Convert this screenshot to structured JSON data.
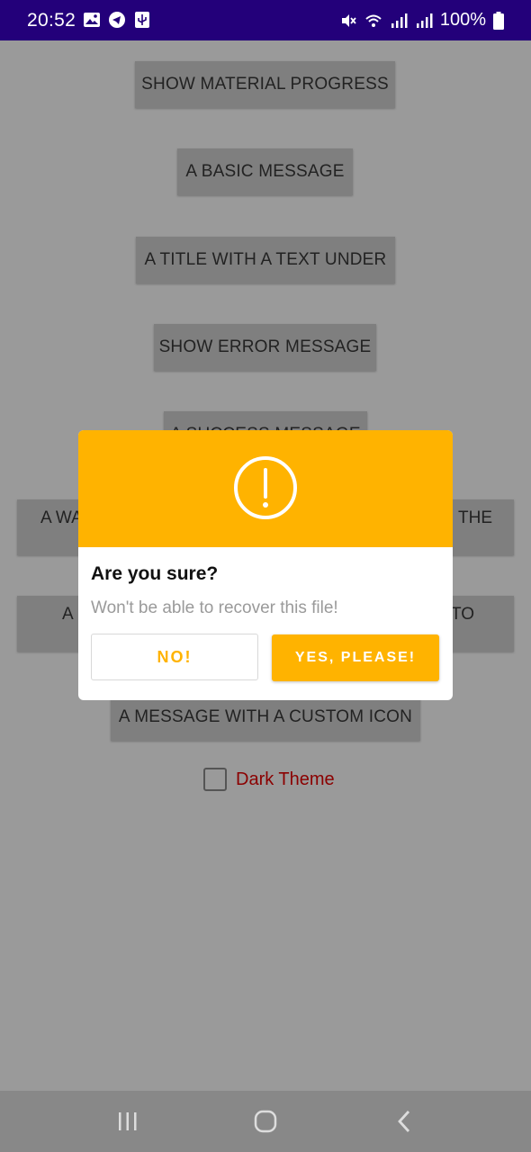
{
  "status_bar": {
    "time": "20:52",
    "battery_percent": "100%",
    "left_icons": [
      "image-icon",
      "telegram-icon",
      "usb-icon"
    ],
    "right_icons": [
      "mute-icon",
      "wifi-icon",
      "signal-icon",
      "signal-icon",
      "battery-icon"
    ]
  },
  "buttons": [
    "SHOW MATERIAL PROGRESS",
    "A BASIC MESSAGE",
    "A TITLE WITH A TEXT UNDER",
    "SHOW ERROR MESSAGE",
    "A SUCCESS MESSAGE",
    "A MESSAGE WITH A CUSTOM ICON"
  ],
  "partial_buttons": {
    "warning_left": "A WA",
    "warning_right": "THE",
    "confirm_left": "A",
    "confirm_right": "TO"
  },
  "dark_theme": {
    "label": "Dark Theme",
    "checked": false
  },
  "dialog": {
    "title": "Are you sure?",
    "message": "Won't be able to recover this file!",
    "cancel_label": "NO!",
    "confirm_label": "YES, PLEASE!",
    "icon": "warning-exclamation-icon"
  },
  "colors": {
    "status_bar": "#23007a",
    "accent": "#ffb300",
    "dark_theme_label": "#8b0000",
    "scrim": "#9a9a9a"
  },
  "nav_bar": {
    "icons": [
      "recent-apps-icon",
      "home-icon",
      "back-icon"
    ]
  }
}
